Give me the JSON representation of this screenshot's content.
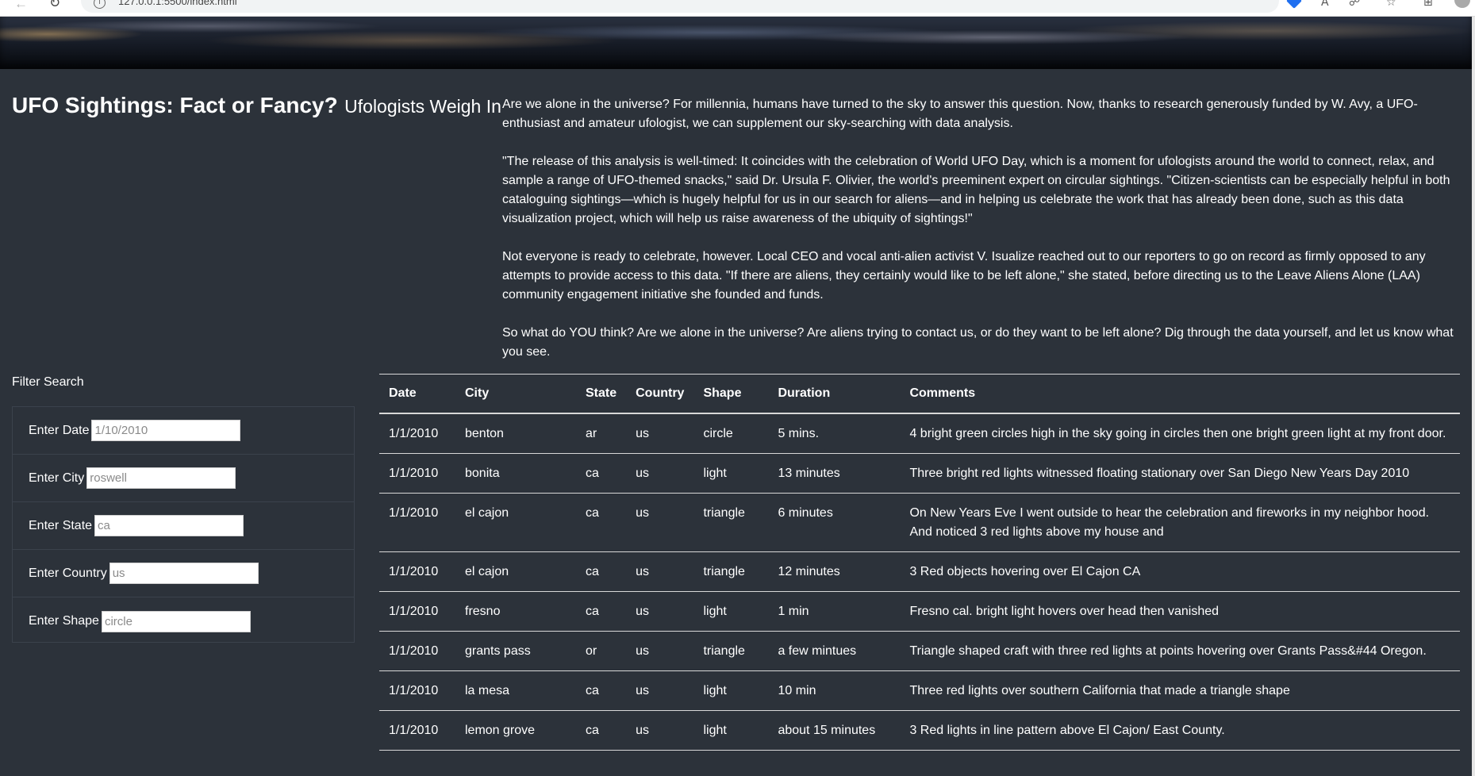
{
  "browser": {
    "url": "127.0.0.1:5500/index.html",
    "icons": {
      "back": "arrow-left-icon",
      "reload": "reload-icon",
      "info": "info-icon",
      "bookmark": "bookmark-icon",
      "read_aloud": "read-aloud-icon",
      "tracking": "tracking-prevention-icon",
      "favorites": "favorites-icon",
      "collections": "collections-icon",
      "profile": "profile-icon"
    }
  },
  "header": {
    "title": "UFO Sightings: Fact or Fancy?",
    "subtitle": "Ufologists Weigh In"
  },
  "intro": {
    "paragraphs": [
      "Are we alone in the universe? For millennia, humans have turned to the sky to answer this question. Now, thanks to research generously funded by W. Avy, a UFO-enthusiast and amateur ufologist, we can supplement our sky-searching with data analysis.",
      "\"The release of this analysis is well-timed: It coincides with the celebration of World UFO Day, which is a moment for ufologists around the world to connect, relax, and sample a range of UFO-themed snacks,\" said Dr. Ursula F. Olivier, the world's preeminent expert on circular sightings. \"Citizen-scientists can be especially helpful in both cataloguing sightings—which is hugely helpful for us in our search for aliens—and in helping us celebrate the work that has already been done, such as this data visualization project, which will help us raise awareness of the ubiquity of sightings!\"",
      "Not everyone is ready to celebrate, however. Local CEO and vocal anti-alien activist V. Isualize reached out to our reporters to go on record as firmly opposed to any attempts to provide access to this data. \"If there are aliens, they certainly would like to be left alone,\" she stated, before directing us to the Leave Aliens Alone (LAA) community engagement initiative she founded and funds.",
      "So what do YOU think? Are we alone in the universe? Are aliens trying to contact us, or do they want to be left alone? Dig through the data yourself, and let us know what you see."
    ]
  },
  "filters": {
    "heading": "Filter Search",
    "date": {
      "label": "Enter Date",
      "placeholder": "1/10/2010"
    },
    "city": {
      "label": "Enter City",
      "placeholder": "roswell"
    },
    "state": {
      "label": "Enter State",
      "placeholder": "ca"
    },
    "country": {
      "label": "Enter Country",
      "placeholder": "us"
    },
    "shape": {
      "label": "Enter Shape",
      "placeholder": "circle"
    }
  },
  "table": {
    "headers": [
      "Date",
      "City",
      "State",
      "Country",
      "Shape",
      "Duration",
      "Comments"
    ],
    "rows": [
      [
        "1/1/2010",
        "benton",
        "ar",
        "us",
        "circle",
        "5 mins.",
        "4 bright green circles high in the sky going in circles then one bright green light at my front door."
      ],
      [
        "1/1/2010",
        "bonita",
        "ca",
        "us",
        "light",
        "13 minutes",
        "Three bright red lights witnessed floating stationary over San Diego New Years Day 2010"
      ],
      [
        "1/1/2010",
        "el cajon",
        "ca",
        "us",
        "triangle",
        "6 minutes",
        "On New Years Eve I went outside to hear the celebration and fireworks in my neighbor hood. And noticed 3 red lights above my house and"
      ],
      [
        "1/1/2010",
        "el cajon",
        "ca",
        "us",
        "triangle",
        "12 minutes",
        "3 Red objects hovering over El Cajon CA"
      ],
      [
        "1/1/2010",
        "fresno",
        "ca",
        "us",
        "light",
        "1 min",
        "Fresno cal. bright light hovers over head then vanished"
      ],
      [
        "1/1/2010",
        "grants pass",
        "or",
        "us",
        "triangle",
        "a few mintues",
        "Triangle shaped craft with three red lights at points hovering over Grants Pass&#44 Oregon."
      ],
      [
        "1/1/2010",
        "la mesa",
        "ca",
        "us",
        "light",
        "10 min",
        "Three red lights over southern California that made a triangle shape"
      ],
      [
        "1/1/2010",
        "lemon grove",
        "ca",
        "us",
        "light",
        "about 15 minutes",
        "3 Red lights in line pattern above El Cajon/ East County."
      ]
    ]
  }
}
